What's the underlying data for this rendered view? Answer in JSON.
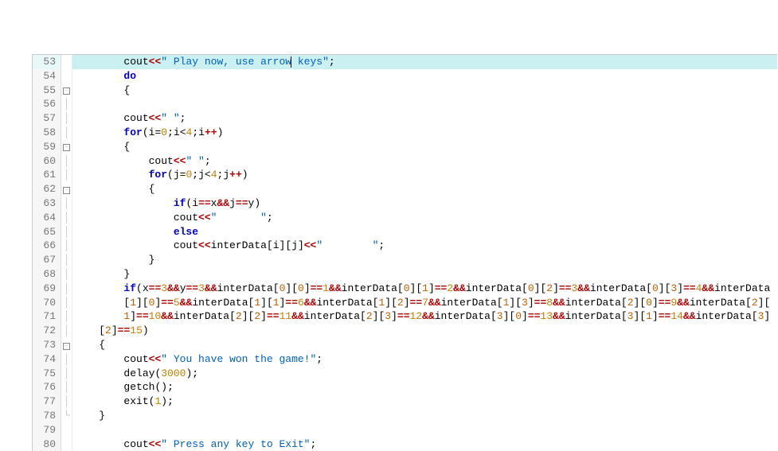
{
  "editor": {
    "first_line": 53,
    "highlighted_line": 53,
    "lines": [
      {
        "n": 53,
        "fold": "",
        "indent": "        ",
        "tokens": [
          [
            "fn",
            "cout"
          ],
          [
            "op-red",
            "<<"
          ],
          [
            "str",
            "\" Play now, use arrow keys\""
          ],
          [
            "op",
            ";"
          ]
        ]
      },
      {
        "n": 54,
        "fold": "",
        "indent": "        ",
        "tokens": [
          [
            "kw",
            "do"
          ]
        ]
      },
      {
        "n": 55,
        "fold": "minus",
        "indent": "        ",
        "tokens": [
          [
            "br",
            "{"
          ]
        ]
      },
      {
        "n": 56,
        "fold": "bar",
        "indent": "",
        "tokens": []
      },
      {
        "n": 57,
        "fold": "bar",
        "indent": "        ",
        "tokens": [
          [
            "fn",
            "cout"
          ],
          [
            "op-red",
            "<<"
          ],
          [
            "str",
            "\" \""
          ],
          [
            "op",
            ";"
          ]
        ]
      },
      {
        "n": 58,
        "fold": "bar",
        "indent": "        ",
        "tokens": [
          [
            "kw",
            "for"
          ],
          [
            "op",
            "("
          ],
          [
            "plain",
            "i"
          ],
          [
            "op",
            "="
          ],
          [
            "num",
            "0"
          ],
          [
            "op",
            ";"
          ],
          [
            "plain",
            "i"
          ],
          [
            "op",
            "<"
          ],
          [
            "num",
            "4"
          ],
          [
            "op",
            ";"
          ],
          [
            "plain",
            "i"
          ],
          [
            "op-red",
            "++"
          ],
          [
            "op",
            ")"
          ]
        ]
      },
      {
        "n": 59,
        "fold": "minus",
        "indent": "        ",
        "tokens": [
          [
            "br",
            "{"
          ]
        ]
      },
      {
        "n": 60,
        "fold": "bar",
        "indent": "            ",
        "tokens": [
          [
            "fn",
            "cout"
          ],
          [
            "op-red",
            "<<"
          ],
          [
            "str",
            "\" \""
          ],
          [
            "op",
            ";"
          ]
        ]
      },
      {
        "n": 61,
        "fold": "bar",
        "indent": "            ",
        "tokens": [
          [
            "kw",
            "for"
          ],
          [
            "op",
            "("
          ],
          [
            "plain",
            "j"
          ],
          [
            "op",
            "="
          ],
          [
            "num",
            "0"
          ],
          [
            "op",
            ";"
          ],
          [
            "plain",
            "j"
          ],
          [
            "op",
            "<"
          ],
          [
            "num",
            "4"
          ],
          [
            "op",
            ";"
          ],
          [
            "plain",
            "j"
          ],
          [
            "op-red",
            "++"
          ],
          [
            "op",
            ")"
          ]
        ]
      },
      {
        "n": 62,
        "fold": "minus",
        "indent": "            ",
        "tokens": [
          [
            "br",
            "{"
          ]
        ]
      },
      {
        "n": 63,
        "fold": "bar",
        "indent": "                ",
        "tokens": [
          [
            "kw",
            "if"
          ],
          [
            "op",
            "("
          ],
          [
            "plain",
            "i"
          ],
          [
            "op-red",
            "=="
          ],
          [
            "plain",
            "x"
          ],
          [
            "op-red",
            "&&"
          ],
          [
            "plain",
            "j"
          ],
          [
            "op-red",
            "=="
          ],
          [
            "plain",
            "y"
          ],
          [
            "op",
            ")"
          ]
        ]
      },
      {
        "n": 64,
        "fold": "bar",
        "indent": "                ",
        "tokens": [
          [
            "fn",
            "cout"
          ],
          [
            "op-red",
            "<<"
          ],
          [
            "str",
            "\"       \""
          ],
          [
            "op",
            ";"
          ]
        ]
      },
      {
        "n": 65,
        "fold": "bar",
        "indent": "                ",
        "tokens": [
          [
            "kw",
            "else"
          ]
        ]
      },
      {
        "n": 66,
        "fold": "bar",
        "indent": "                ",
        "tokens": [
          [
            "fn",
            "cout"
          ],
          [
            "op-red",
            "<<"
          ],
          [
            "plain",
            "interData"
          ],
          [
            "op",
            "["
          ],
          [
            "plain",
            "i"
          ],
          [
            "op",
            "]"
          ],
          [
            "op",
            "["
          ],
          [
            "plain",
            "j"
          ],
          [
            "op",
            "]"
          ],
          [
            "op-red",
            "<<"
          ],
          [
            "str",
            "\"        \""
          ],
          [
            "op",
            ";"
          ]
        ]
      },
      {
        "n": 67,
        "fold": "bar",
        "indent": "            ",
        "tokens": [
          [
            "br",
            "}"
          ]
        ]
      },
      {
        "n": 68,
        "fold": "bar",
        "indent": "        ",
        "tokens": [
          [
            "br",
            "}"
          ]
        ]
      },
      {
        "n": 69,
        "fold": "bar",
        "indent": "        ",
        "tokens": [
          [
            "kw",
            "if"
          ],
          [
            "op",
            "("
          ],
          [
            "plain",
            "x"
          ],
          [
            "op-red",
            "=="
          ],
          [
            "num",
            "3"
          ],
          [
            "op-red",
            "&&"
          ],
          [
            "plain",
            "y"
          ],
          [
            "op-red",
            "=="
          ],
          [
            "num",
            "3"
          ],
          [
            "op-red",
            "&&"
          ],
          [
            "plain",
            "interData"
          ],
          [
            "op",
            "["
          ],
          [
            "idx",
            "0"
          ],
          [
            "op",
            "]"
          ],
          [
            "op",
            "["
          ],
          [
            "idx",
            "0"
          ],
          [
            "op",
            "]"
          ],
          [
            "op-red",
            "=="
          ],
          [
            "num",
            "1"
          ],
          [
            "op-red",
            "&&"
          ],
          [
            "plain",
            "interData"
          ],
          [
            "op",
            "["
          ],
          [
            "idx",
            "0"
          ],
          [
            "op",
            "]"
          ],
          [
            "op",
            "["
          ],
          [
            "idx",
            "1"
          ],
          [
            "op",
            "]"
          ],
          [
            "op-red",
            "=="
          ],
          [
            "num",
            "2"
          ],
          [
            "op-red",
            "&&"
          ],
          [
            "plain",
            "interData"
          ],
          [
            "op",
            "["
          ],
          [
            "idx",
            "0"
          ],
          [
            "op",
            "]"
          ],
          [
            "op",
            "["
          ],
          [
            "idx",
            "2"
          ],
          [
            "op",
            "]"
          ],
          [
            "op-red",
            "=="
          ],
          [
            "num",
            "3"
          ],
          [
            "op-red",
            "&&"
          ],
          [
            "plain",
            "interData"
          ],
          [
            "op",
            "["
          ],
          [
            "idx",
            "0"
          ],
          [
            "op",
            "]"
          ],
          [
            "op",
            "["
          ],
          [
            "idx",
            "3"
          ],
          [
            "op",
            "]"
          ],
          [
            "op-red",
            "=="
          ],
          [
            "num",
            "4"
          ],
          [
            "op-red",
            "&&"
          ],
          [
            "plain",
            "interData"
          ]
        ]
      },
      {
        "n": 70,
        "fold": "bar",
        "indent": "        ",
        "tokens": [
          [
            "op",
            "["
          ],
          [
            "idx",
            "1"
          ],
          [
            "op",
            "]"
          ],
          [
            "op",
            "["
          ],
          [
            "idx",
            "0"
          ],
          [
            "op",
            "]"
          ],
          [
            "op-red",
            "=="
          ],
          [
            "num",
            "5"
          ],
          [
            "op-red",
            "&&"
          ],
          [
            "plain",
            "interData"
          ],
          [
            "op",
            "["
          ],
          [
            "idx",
            "1"
          ],
          [
            "op",
            "]"
          ],
          [
            "op",
            "["
          ],
          [
            "idx",
            "1"
          ],
          [
            "op",
            "]"
          ],
          [
            "op-red",
            "=="
          ],
          [
            "num",
            "6"
          ],
          [
            "op-red",
            "&&"
          ],
          [
            "plain",
            "interData"
          ],
          [
            "op",
            "["
          ],
          [
            "idx",
            "1"
          ],
          [
            "op",
            "]"
          ],
          [
            "op",
            "["
          ],
          [
            "idx",
            "2"
          ],
          [
            "op",
            "]"
          ],
          [
            "op-red",
            "=="
          ],
          [
            "num",
            "7"
          ],
          [
            "op-red",
            "&&"
          ],
          [
            "plain",
            "interData"
          ],
          [
            "op",
            "["
          ],
          [
            "idx",
            "1"
          ],
          [
            "op",
            "]"
          ],
          [
            "op",
            "["
          ],
          [
            "idx",
            "3"
          ],
          [
            "op",
            "]"
          ],
          [
            "op-red",
            "=="
          ],
          [
            "num",
            "8"
          ],
          [
            "op-red",
            "&&"
          ],
          [
            "plain",
            "interData"
          ],
          [
            "op",
            "["
          ],
          [
            "idx",
            "2"
          ],
          [
            "op",
            "]"
          ],
          [
            "op",
            "["
          ],
          [
            "idx",
            "0"
          ],
          [
            "op",
            "]"
          ],
          [
            "op-red",
            "=="
          ],
          [
            "num",
            "9"
          ],
          [
            "op-red",
            "&&"
          ],
          [
            "plain",
            "interData"
          ],
          [
            "op",
            "["
          ],
          [
            "idx",
            "2"
          ],
          [
            "op",
            "]"
          ],
          [
            "op",
            "["
          ]
        ]
      },
      {
        "n": 71,
        "fold": "bar",
        "indent": "        ",
        "tokens": [
          [
            "idx",
            "1"
          ],
          [
            "op",
            "]"
          ],
          [
            "op-red",
            "=="
          ],
          [
            "num",
            "10"
          ],
          [
            "op-red",
            "&&"
          ],
          [
            "plain",
            "interData"
          ],
          [
            "op",
            "["
          ],
          [
            "idx",
            "2"
          ],
          [
            "op",
            "]"
          ],
          [
            "op",
            "["
          ],
          [
            "idx",
            "2"
          ],
          [
            "op",
            "]"
          ],
          [
            "op-red",
            "=="
          ],
          [
            "num",
            "11"
          ],
          [
            "op-red",
            "&&"
          ],
          [
            "plain",
            "interData"
          ],
          [
            "op",
            "["
          ],
          [
            "idx",
            "2"
          ],
          [
            "op",
            "]"
          ],
          [
            "op",
            "["
          ],
          [
            "idx",
            "3"
          ],
          [
            "op",
            "]"
          ],
          [
            "op-red",
            "=="
          ],
          [
            "num",
            "12"
          ],
          [
            "op-red",
            "&&"
          ],
          [
            "plain",
            "interData"
          ],
          [
            "op",
            "["
          ],
          [
            "idx",
            "3"
          ],
          [
            "op",
            "]"
          ],
          [
            "op",
            "["
          ],
          [
            "idx",
            "0"
          ],
          [
            "op",
            "]"
          ],
          [
            "op-red",
            "=="
          ],
          [
            "num",
            "13"
          ],
          [
            "op-red",
            "&&"
          ],
          [
            "plain",
            "interData"
          ],
          [
            "op",
            "["
          ],
          [
            "idx",
            "3"
          ],
          [
            "op",
            "]"
          ],
          [
            "op",
            "["
          ],
          [
            "idx",
            "1"
          ],
          [
            "op",
            "]"
          ],
          [
            "op-red",
            "=="
          ],
          [
            "num",
            "14"
          ],
          [
            "op-red",
            "&&"
          ],
          [
            "plain",
            "interData"
          ],
          [
            "op",
            "["
          ],
          [
            "idx",
            "3"
          ],
          [
            "op",
            "]"
          ]
        ]
      },
      {
        "n": 72,
        "fold": "bar",
        "indent": "    ",
        "tokens": [
          [
            "op",
            "["
          ],
          [
            "idx",
            "2"
          ],
          [
            "op",
            "]"
          ],
          [
            "op-red",
            "=="
          ],
          [
            "num",
            "15"
          ],
          [
            "op",
            ")"
          ]
        ]
      },
      {
        "n": 73,
        "fold": "minus",
        "indent": "    ",
        "tokens": [
          [
            "br",
            "{"
          ]
        ]
      },
      {
        "n": 74,
        "fold": "bar",
        "indent": "        ",
        "tokens": [
          [
            "fn",
            "cout"
          ],
          [
            "op-red",
            "<<"
          ],
          [
            "str",
            "\" You have won the game!\""
          ],
          [
            "op",
            ";"
          ]
        ]
      },
      {
        "n": 75,
        "fold": "bar",
        "indent": "        ",
        "tokens": [
          [
            "fn",
            "delay"
          ],
          [
            "op",
            "("
          ],
          [
            "num",
            "3000"
          ],
          [
            "op",
            ")"
          ],
          [
            "op",
            ";"
          ]
        ]
      },
      {
        "n": 76,
        "fold": "bar",
        "indent": "        ",
        "tokens": [
          [
            "fn",
            "getch"
          ],
          [
            "op",
            "("
          ],
          [
            "op",
            ")"
          ],
          [
            "op",
            ";"
          ]
        ]
      },
      {
        "n": 77,
        "fold": "bar",
        "indent": "        ",
        "tokens": [
          [
            "fn",
            "exit"
          ],
          [
            "op",
            "("
          ],
          [
            "num",
            "1"
          ],
          [
            "op",
            ")"
          ],
          [
            "op",
            ";"
          ]
        ]
      },
      {
        "n": 78,
        "fold": "end",
        "indent": "    ",
        "tokens": [
          [
            "br",
            "}"
          ]
        ]
      },
      {
        "n": 79,
        "fold": "",
        "indent": "",
        "tokens": []
      },
      {
        "n": 80,
        "fold": "",
        "indent": "        ",
        "tokens": [
          [
            "fn",
            "cout"
          ],
          [
            "op-red",
            "<<"
          ],
          [
            "str",
            "\" Press any key to Exit\""
          ],
          [
            "op",
            ";"
          ]
        ]
      }
    ]
  }
}
